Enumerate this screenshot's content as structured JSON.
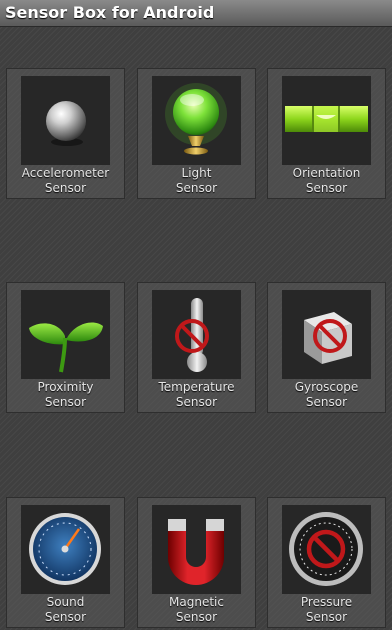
{
  "app": {
    "title": "Sensor Box for Android"
  },
  "tiles": [
    {
      "line1": "Accelerometer",
      "line2": "Sensor",
      "icon": "silver-ball-icon"
    },
    {
      "line1": "Light",
      "line2": "Sensor",
      "icon": "green-crystal-ball-icon"
    },
    {
      "line1": "Orientation",
      "line2": "Sensor",
      "icon": "spirit-level-icon"
    },
    {
      "line1": "Proximity",
      "line2": "Sensor",
      "icon": "sprout-icon"
    },
    {
      "line1": "Temperature",
      "line2": "Sensor",
      "icon": "thermometer-unavailable-icon"
    },
    {
      "line1": "Gyroscope",
      "line2": "Sensor",
      "icon": "cube-unavailable-icon"
    },
    {
      "line1": "Sound",
      "line2": "Sensor",
      "icon": "sound-gauge-icon"
    },
    {
      "line1": "Magnetic",
      "line2": "Sensor",
      "icon": "magnet-icon"
    },
    {
      "line1": "Pressure",
      "line2": "Sensor",
      "icon": "pressure-gauge-unavailable-icon"
    }
  ],
  "colors": {
    "background": "#3f3f3f",
    "titlebar": "#7a7a7a",
    "unavailable_red": "#c0181a",
    "light_green": "#5fd02a"
  }
}
